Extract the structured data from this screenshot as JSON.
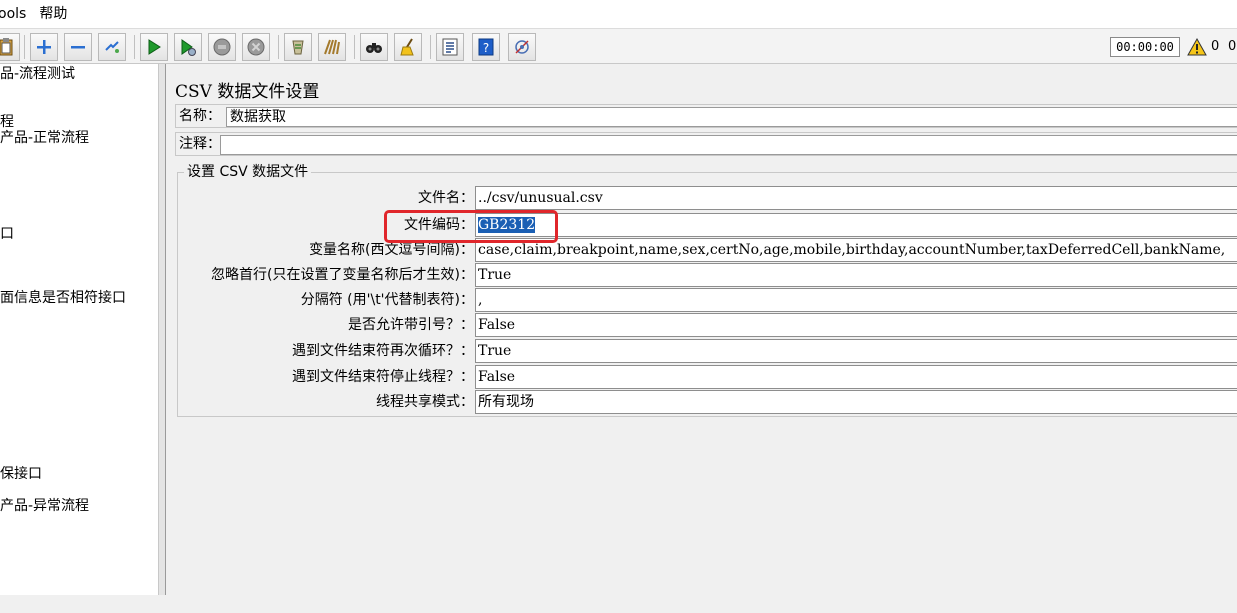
{
  "menubar": {
    "items": [
      "ools",
      "帮助"
    ]
  },
  "toolbar": {
    "buttons": [
      {
        "name": "paste-icon"
      },
      {
        "name": "expand-plus-icon"
      },
      {
        "name": "collapse-minus-icon"
      },
      {
        "name": "toggle-icon"
      },
      {
        "name": "start-icon"
      },
      {
        "name": "start-no-pauses-icon"
      },
      {
        "name": "stop-icon"
      },
      {
        "name": "shutdown-icon"
      },
      {
        "name": "clear-icon"
      },
      {
        "name": "clear-all-icon"
      },
      {
        "name": "search-binoculars-icon"
      },
      {
        "name": "reset-search-broom-icon"
      },
      {
        "name": "function-helper-icon"
      },
      {
        "name": "help-icon"
      },
      {
        "name": "remote-start-icon"
      }
    ],
    "timer": "00:00:00",
    "warning_count": "0",
    "extra_count": "0"
  },
  "tree": {
    "items": [
      "品-流程测试",
      "程",
      "产品-正常流程",
      "口",
      "面信息是否相符接口",
      "保接口",
      "产品-异常流程"
    ]
  },
  "panel": {
    "title": "CSV 数据文件设置",
    "name_label": "名称：",
    "name_value": "数据获取",
    "comment_label": "注释：",
    "comment_value": "",
    "group_title": "设置 CSV 数据文件",
    "fields": [
      {
        "label": "文件名：",
        "value": "../csv/unusual.csv"
      },
      {
        "label": "文件编码：",
        "value": "GB2312"
      },
      {
        "label": "变量名称(西文逗号间隔)：",
        "value": "case,claim,breakpoint,name,sex,certNo,age,mobile,birthday,accountNumber,taxDeferredCell,bankName,"
      },
      {
        "label": "忽略首行(只在设置了变量名称后才生效)：",
        "value": "True"
      },
      {
        "label": "分隔符 (用'\\t'代替制表符)：",
        "value": ","
      },
      {
        "label": "是否允许带引号？：",
        "value": "False"
      },
      {
        "label": "遇到文件结束符再次循环？：",
        "value": "True"
      },
      {
        "label": "遇到文件结束符停止线程？：",
        "value": "False"
      },
      {
        "label": "线程共享模式：",
        "value": "所有现场"
      }
    ]
  },
  "colors": {
    "highlight_box": "#e0262b",
    "selection": "#1a5fb4"
  }
}
